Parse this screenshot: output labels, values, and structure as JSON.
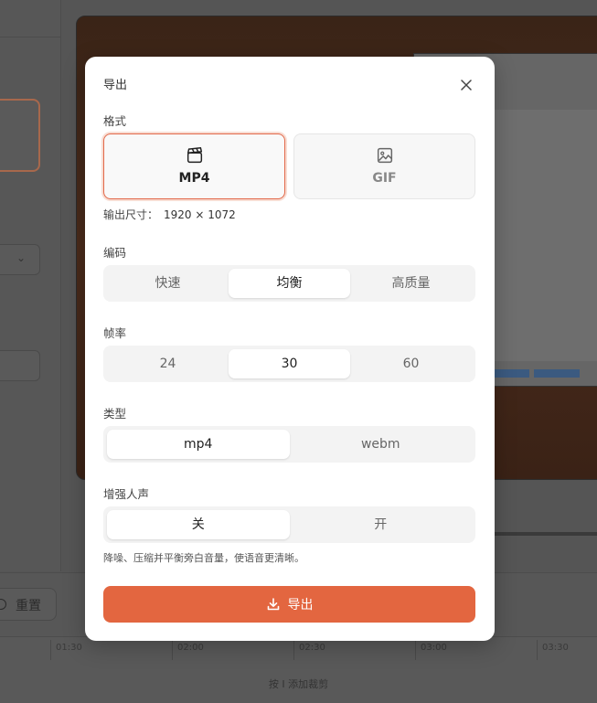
{
  "background": {
    "reset_label": "重置",
    "timeline_ticks": [
      "01:30",
      "02:00",
      "02:30",
      "03:00",
      "03:30"
    ],
    "hint": "按 I 添加裁剪"
  },
  "modal": {
    "title": "导出",
    "close_icon": "close-icon",
    "format": {
      "label": "格式",
      "options": [
        {
          "label": "MP4",
          "icon": "clapperboard-icon",
          "selected": true
        },
        {
          "label": "GIF",
          "icon": "image-icon",
          "selected": false
        }
      ]
    },
    "output_size": {
      "label": "输出尺寸：",
      "value": "1920 × 1072"
    },
    "encoding": {
      "label": "编码",
      "options": [
        "快速",
        "均衡",
        "高质量"
      ],
      "selected": "均衡"
    },
    "framerate": {
      "label": "帧率",
      "options": [
        "24",
        "30",
        "60"
      ],
      "selected": "30"
    },
    "type": {
      "label": "类型",
      "options": [
        "mp4",
        "webm"
      ],
      "selected": "mp4"
    },
    "voice_enhance": {
      "label": "增强人声",
      "options": [
        "关",
        "开"
      ],
      "selected": "关",
      "description": "降噪、压缩并平衡旁白音量，使语音更清晰。"
    },
    "export_button": {
      "label": "导出",
      "icon": "download-icon",
      "color": "#e36640"
    }
  },
  "colors": {
    "accent": "#e36640",
    "selected_border": "#e2694a"
  }
}
